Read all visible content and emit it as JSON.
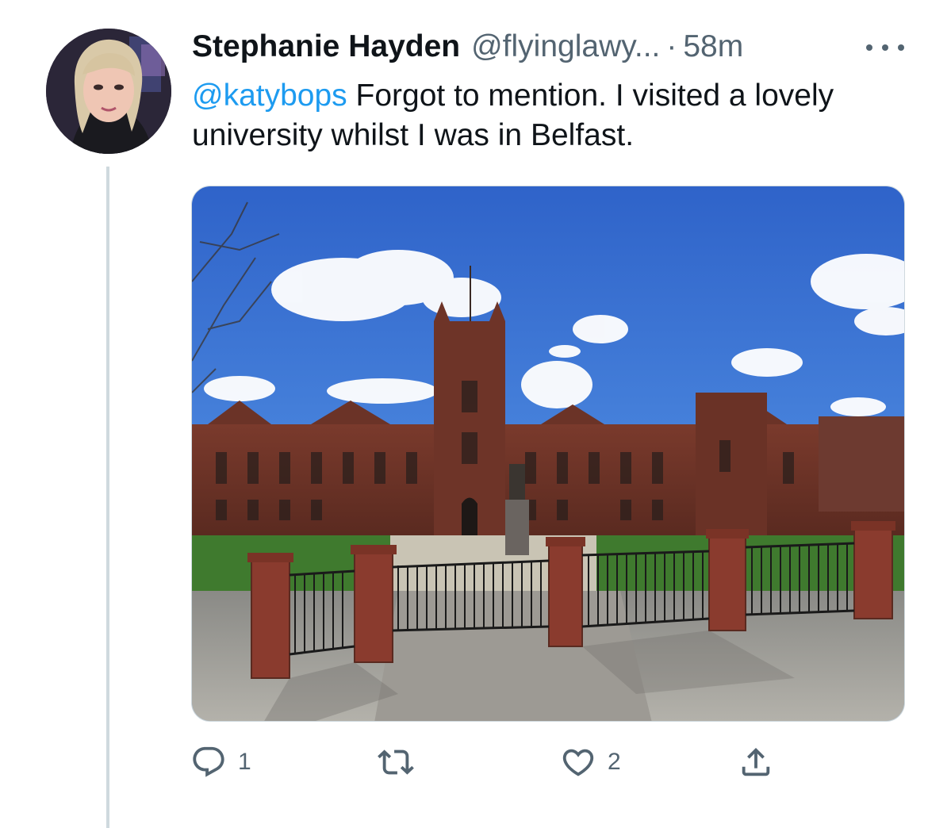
{
  "tweet": {
    "author": {
      "display_name": "Stephanie Hayden",
      "handle": "@flyinglawy...",
      "avatar": "profile-photo"
    },
    "separator": "·",
    "time": "58m",
    "mention": "@katybops",
    "text": " Forgot to mention. I visited a lovely university whilst I was in Belfast.",
    "media": {
      "type": "photo",
      "subject": "red-brick university building with iron gates under blue sky"
    },
    "actions": {
      "reply": {
        "icon": "reply-icon",
        "count": "1"
      },
      "retweet": {
        "icon": "retweet-icon",
        "count": ""
      },
      "like": {
        "icon": "heart-icon",
        "count": "2"
      },
      "share": {
        "icon": "share-icon",
        "count": ""
      }
    },
    "more_icon": "more-icon"
  },
  "colors": {
    "link": "#1d9bf0",
    "secondary_text": "#536471",
    "primary_text": "#0f1419",
    "thread_line": "#cfd9de"
  }
}
